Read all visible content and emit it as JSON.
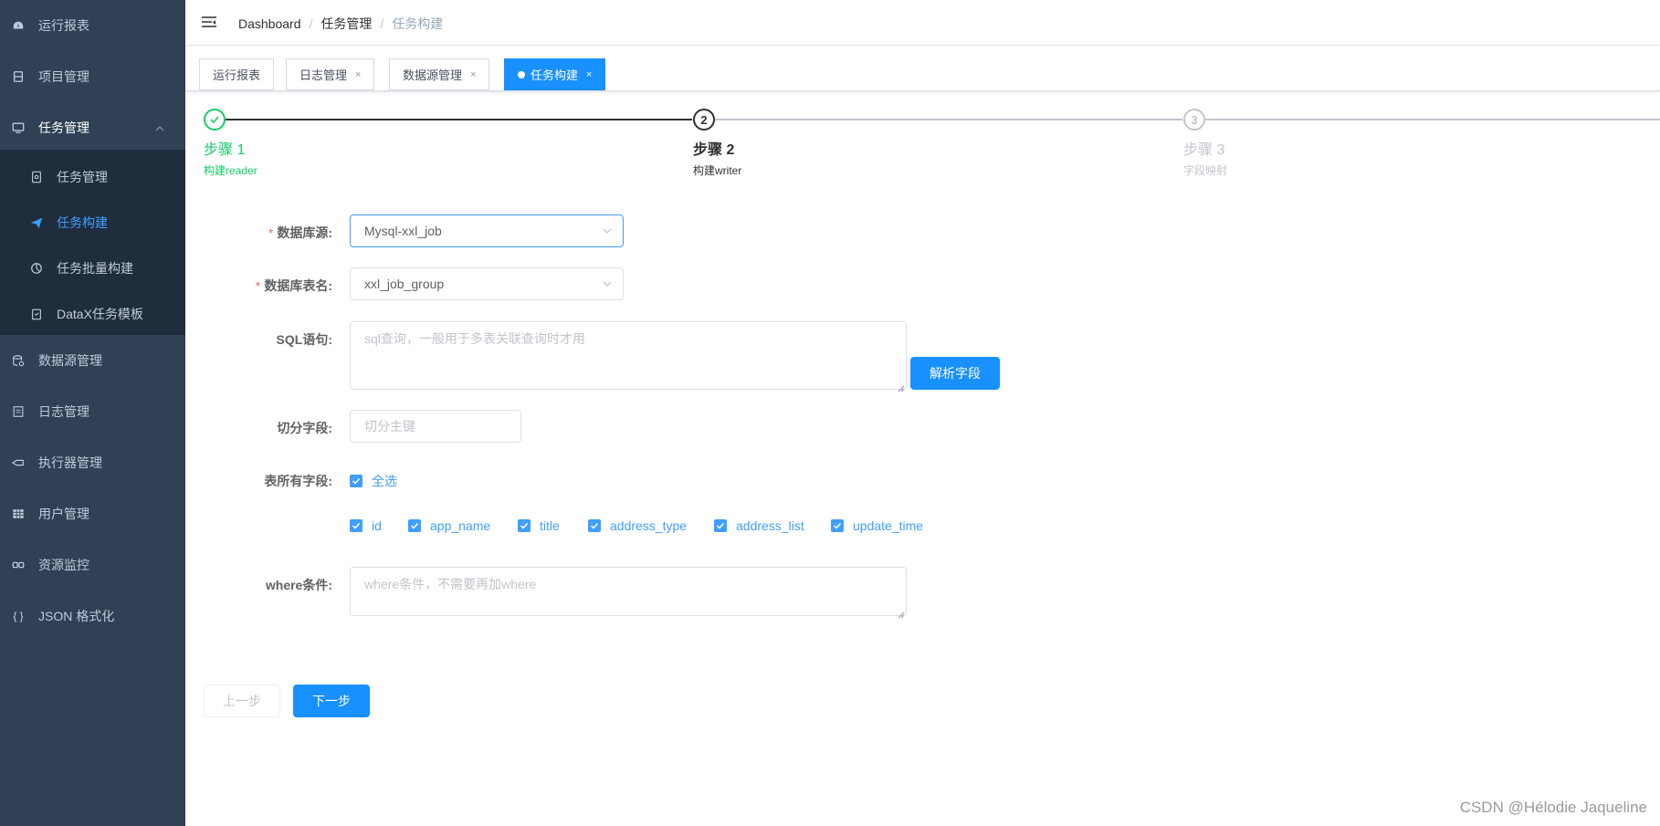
{
  "sidebar": {
    "items": [
      {
        "label": "运行报表",
        "icon": "dashboard-icon"
      },
      {
        "label": "项目管理",
        "icon": "project-icon"
      },
      {
        "label": "任务管理",
        "icon": "monitor-icon"
      },
      {
        "label": "数据源管理",
        "icon": "database-icon"
      },
      {
        "label": "日志管理",
        "icon": "log-icon"
      },
      {
        "label": "执行器管理",
        "icon": "executor-icon"
      },
      {
        "label": "用户管理",
        "icon": "user-table-icon"
      },
      {
        "label": "资源监控",
        "icon": "monitor-link-icon"
      },
      {
        "label": "JSON 格式化",
        "icon": "braces-icon"
      }
    ],
    "submenu": [
      {
        "label": "任务管理",
        "icon": "task-doc-icon"
      },
      {
        "label": "任务构建",
        "icon": "send-icon"
      },
      {
        "label": "任务批量构建",
        "icon": "chart-icon"
      },
      {
        "label": "DataX任务模板",
        "icon": "clipboard-icon"
      }
    ]
  },
  "breadcrumb": [
    "Dashboard",
    "任务管理",
    "任务构建"
  ],
  "tags": [
    {
      "label": "运行报表"
    },
    {
      "label": "日志管理",
      "close": "×"
    },
    {
      "label": "数据源管理",
      "close": "×"
    },
    {
      "label": "任务构建",
      "close": "×"
    }
  ],
  "steps": [
    {
      "title": "步骤 1",
      "desc": "构建reader"
    },
    {
      "title": "步骤 2",
      "desc": "构建writer",
      "num": "2"
    },
    {
      "title": "步骤 3",
      "desc": "字段映射",
      "num": "3"
    }
  ],
  "form": {
    "required_mark": "*",
    "datasource_label": "数据库源:",
    "datasource_value": "Mysql-xxl_job",
    "table_label": "数据库表名:",
    "table_value": "xxl_job_group",
    "sql_label": "SQL语句:",
    "sql_placeholder": "sql查询，一般用于多表关联查询时才用",
    "parse_button": "解析字段",
    "split_label": "切分字段:",
    "split_placeholder": "切分主键",
    "fields_label": "表所有字段:",
    "select_all": "全选",
    "fields": [
      "id",
      "app_name",
      "title",
      "address_type",
      "address_list",
      "update_time"
    ],
    "where_label": "where条件:",
    "where_placeholder": "where条件，不需要再加where",
    "prev_button": "上一步",
    "next_button": "下一步"
  },
  "watermark": "CSDN @Hélodie Jaqueline",
  "colors": {
    "sidebar_bg": "#304156",
    "submenu_bg": "#1f2d3d",
    "primary": "#1890ff",
    "success": "#13ce66",
    "active_menu": "#409eff"
  }
}
